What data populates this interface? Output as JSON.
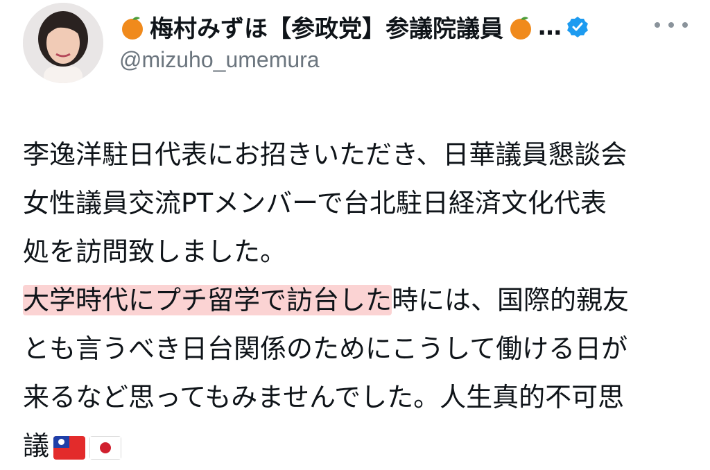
{
  "profile": {
    "display_name": "梅村みずほ【参政党】参議院議員",
    "ellipsis": "…",
    "handle": "@mizuho_umemura",
    "name_icons": [
      "orange-icon",
      "orange-icon",
      "verified-badge-icon"
    ],
    "verified_color": "#1d9bf0"
  },
  "tweet": {
    "lines": [
      "李逸洋駐日代表にお招きいただき、日華議員懇談会",
      "女性議員交流PTメンバーで台北駐日経済文化代表",
      "処を訪問致しました。"
    ],
    "line4_highlight": "大学時代にプチ留学で訪台した",
    "line4_rest": "時には、国際的親友",
    "line5": "とも言うべき日台関係のためにこうして働ける日が",
    "line6": "来るなど思ってもみませんでした。人生真的不可思",
    "line7": "議",
    "flags": [
      "taiwan-flag-icon",
      "japan-flag-icon"
    ],
    "highlight_color": "#fbd3d3"
  },
  "menu": {
    "icon": "more-options-icon"
  }
}
